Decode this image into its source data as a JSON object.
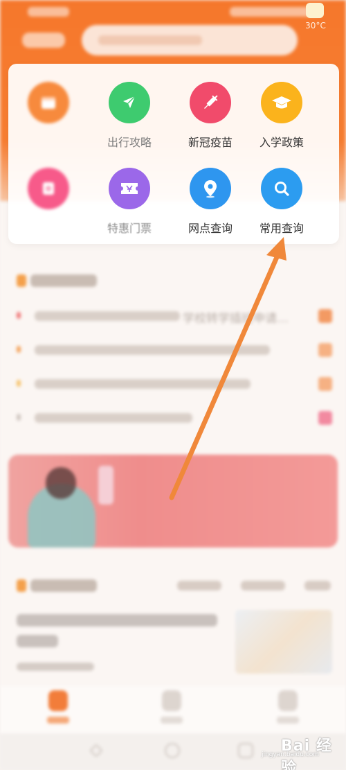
{
  "header": {
    "weather_temp": "30°C"
  },
  "services": {
    "items": [
      {
        "label": "",
        "icon": "calendar-icon",
        "color": "#f78a3d",
        "blurred": true
      },
      {
        "label": "出行攻略",
        "icon": "paper-plane-icon",
        "color": "#3ecb6f",
        "blurred": false
      },
      {
        "label": "新冠疫苗",
        "icon": "syringe-icon",
        "color": "#f14b6b",
        "blurred": false
      },
      {
        "label": "入学政策",
        "icon": "graduation-cap-icon",
        "color": "#fbb31c",
        "blurred": false
      },
      {
        "label": "",
        "icon": "clipboard-icon",
        "color": "#f75a8a",
        "blurred": true
      },
      {
        "label": "特惠门票",
        "icon": "ticket-icon",
        "color": "#9b68e9",
        "blurred": false
      },
      {
        "label": "网点查询",
        "icon": "location-pin-icon",
        "color": "#2e96ef",
        "blurred": false
      },
      {
        "label": "常用查询",
        "icon": "magnifier-icon",
        "color": "#2c9cf0",
        "blurred": false
      }
    ]
  },
  "news": {
    "first_item_partial": "学校转学插班申请…"
  },
  "annotation": {
    "arrow_color": "#f0883a"
  },
  "watermark": {
    "brand": "Bai 经验",
    "url": "jingyan.baidu.com"
  }
}
